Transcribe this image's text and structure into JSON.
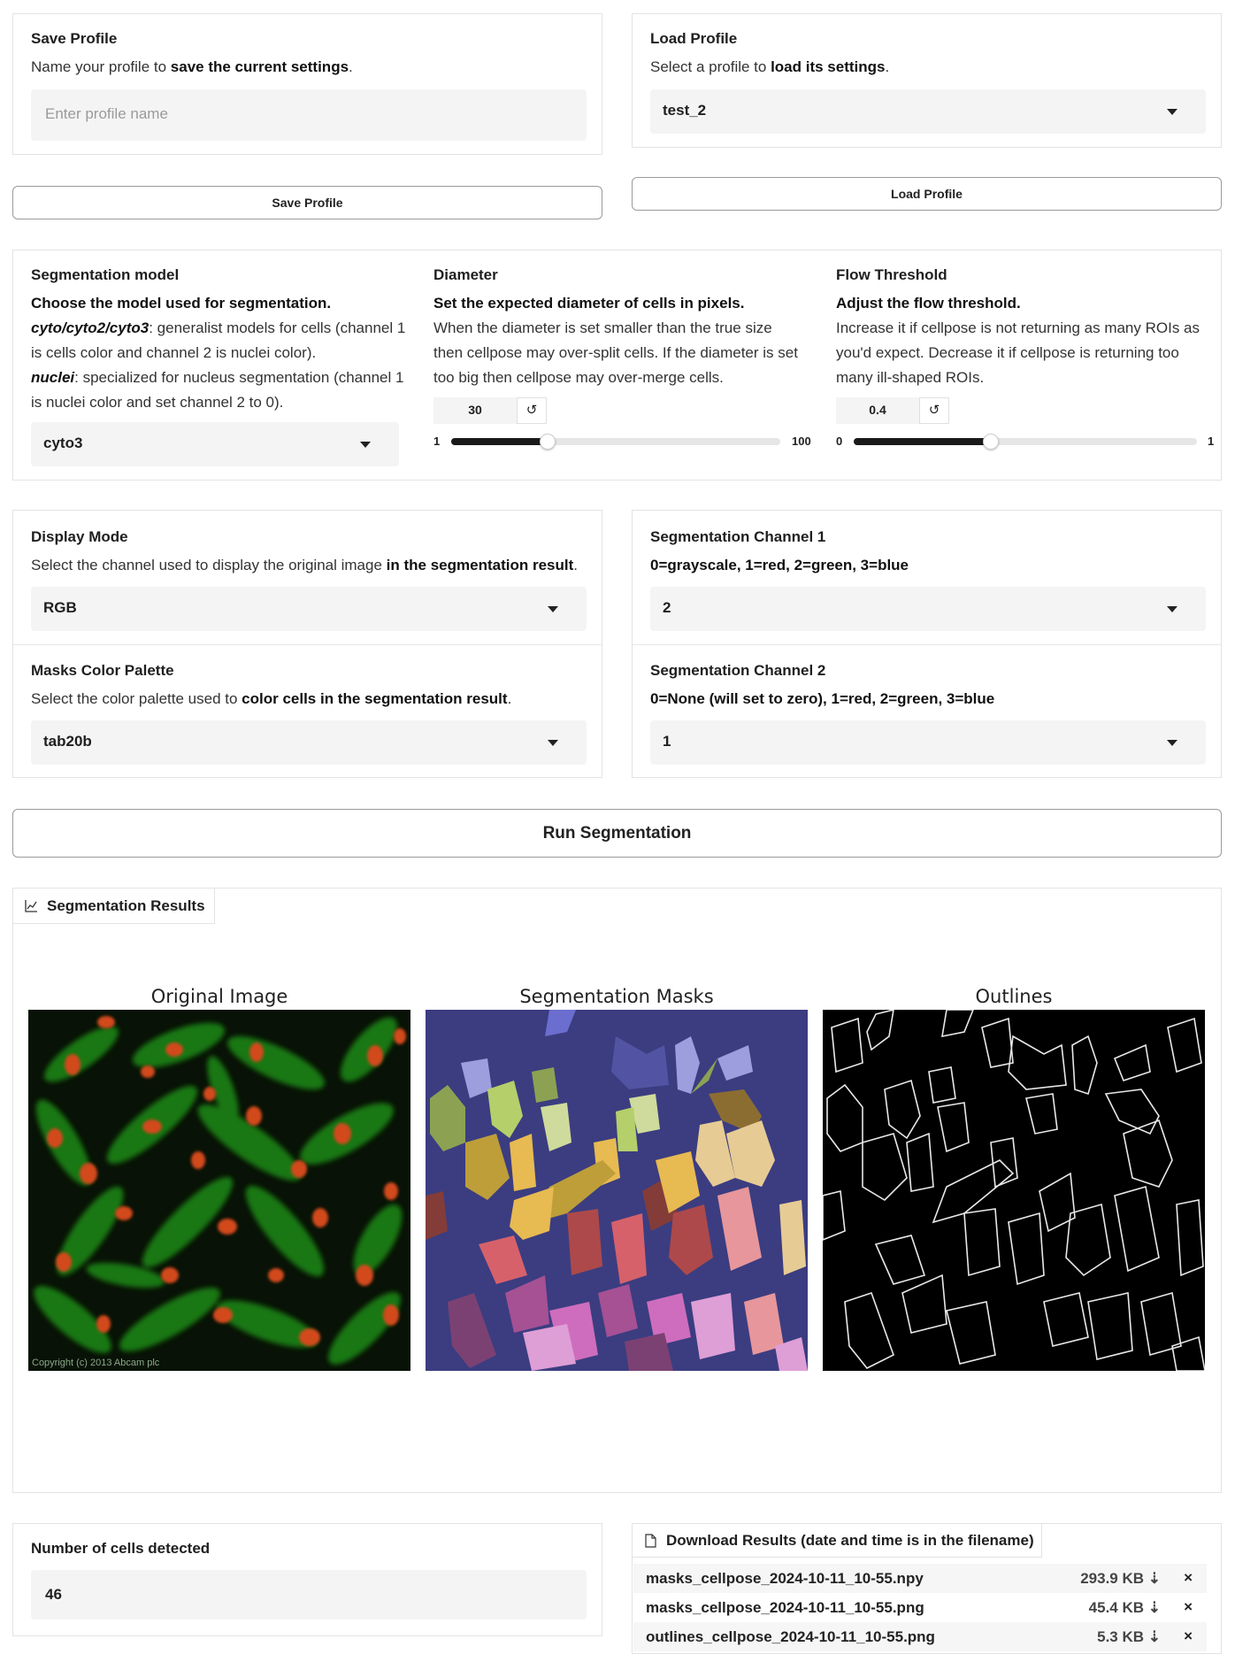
{
  "save_profile": {
    "label": "Save Profile",
    "desc_prefix": "Name your profile to ",
    "desc_bold": "save the current settings",
    "desc_suffix": ".",
    "placeholder": "Enter profile name",
    "button": "Save Profile"
  },
  "load_profile": {
    "label": "Load Profile",
    "desc_prefix": "Select a profile to ",
    "desc_bold": "load its settings",
    "desc_suffix": ".",
    "value": "test_2",
    "button": "Load Profile"
  },
  "seg_model": {
    "label": "Segmentation model",
    "desc_bold": "Choose the model used for segmentation.",
    "line1_em": "cyto/cyto2/cyto3",
    "line1_text": ": generalist models for cells (channel 1 is cells color and channel 2 is nuclei color).",
    "line2_em": "nuclei",
    "line2_text": ": specialized for nucleus segmentation (channel 1 is nuclei color and set channel 2 to 0).",
    "value": "cyto3"
  },
  "diameter": {
    "label": "Diameter",
    "desc_bold": "Set the expected diameter of cells in pixels.",
    "desc": "When the diameter is set smaller than the true size then cellpose may over-split cells. If the diameter is set too big then cellpose may over-merge cells.",
    "value": "30",
    "reset": "↺",
    "min": "1",
    "max": "100",
    "fraction": 0.293
  },
  "flow_threshold": {
    "label": "Flow Threshold",
    "desc_bold": "Adjust the flow threshold.",
    "desc": "Increase it if cellpose is not returning as many ROIs as you'd expect. Decrease it if cellpose is returning too many ill-shaped ROIs.",
    "value": "0.4",
    "reset": "↺",
    "min": "0",
    "max": "1",
    "fraction": 0.4
  },
  "display_mode": {
    "label": "Display Mode",
    "desc_prefix": "Select the channel used to display the original image ",
    "desc_bold": "in the segmentation result",
    "desc_suffix": ".",
    "value": "RGB"
  },
  "masks_palette": {
    "label": "Masks Color Palette",
    "desc_prefix": "Select the color palette used to ",
    "desc_bold": "color cells in the segmentation result",
    "desc_suffix": ".",
    "value": "tab20b"
  },
  "seg_channel_1": {
    "label": "Segmentation Channel 1",
    "desc": "0=grayscale, 1=red, 2=green, 3=blue",
    "value": "2"
  },
  "seg_channel_2": {
    "label": "Segmentation Channel 2",
    "desc": "0=None (will set to zero), 1=red, 2=green, 3=blue",
    "value": "1"
  },
  "run_button": "Run Segmentation",
  "results": {
    "tab_label": "Segmentation Results",
    "titles": [
      "Original Image",
      "Segmentation Masks",
      "Outlines"
    ],
    "watermark": "Copyright (c) 2013 Abcam plc"
  },
  "cells": {
    "label": "Number of cells detected",
    "value": "46"
  },
  "downloads": {
    "label": "Download Results (date and time is in the filename)",
    "files": [
      {
        "name": "masks_cellpose_2024-10-11_10-55.npy",
        "size": "293.9 KB ⇣"
      },
      {
        "name": "masks_cellpose_2024-10-11_10-55.png",
        "size": "45.4 KB ⇣"
      },
      {
        "name": "outlines_cellpose_2024-10-11_10-55.png",
        "size": "5.3 KB ⇣"
      }
    ],
    "remove": "×"
  }
}
